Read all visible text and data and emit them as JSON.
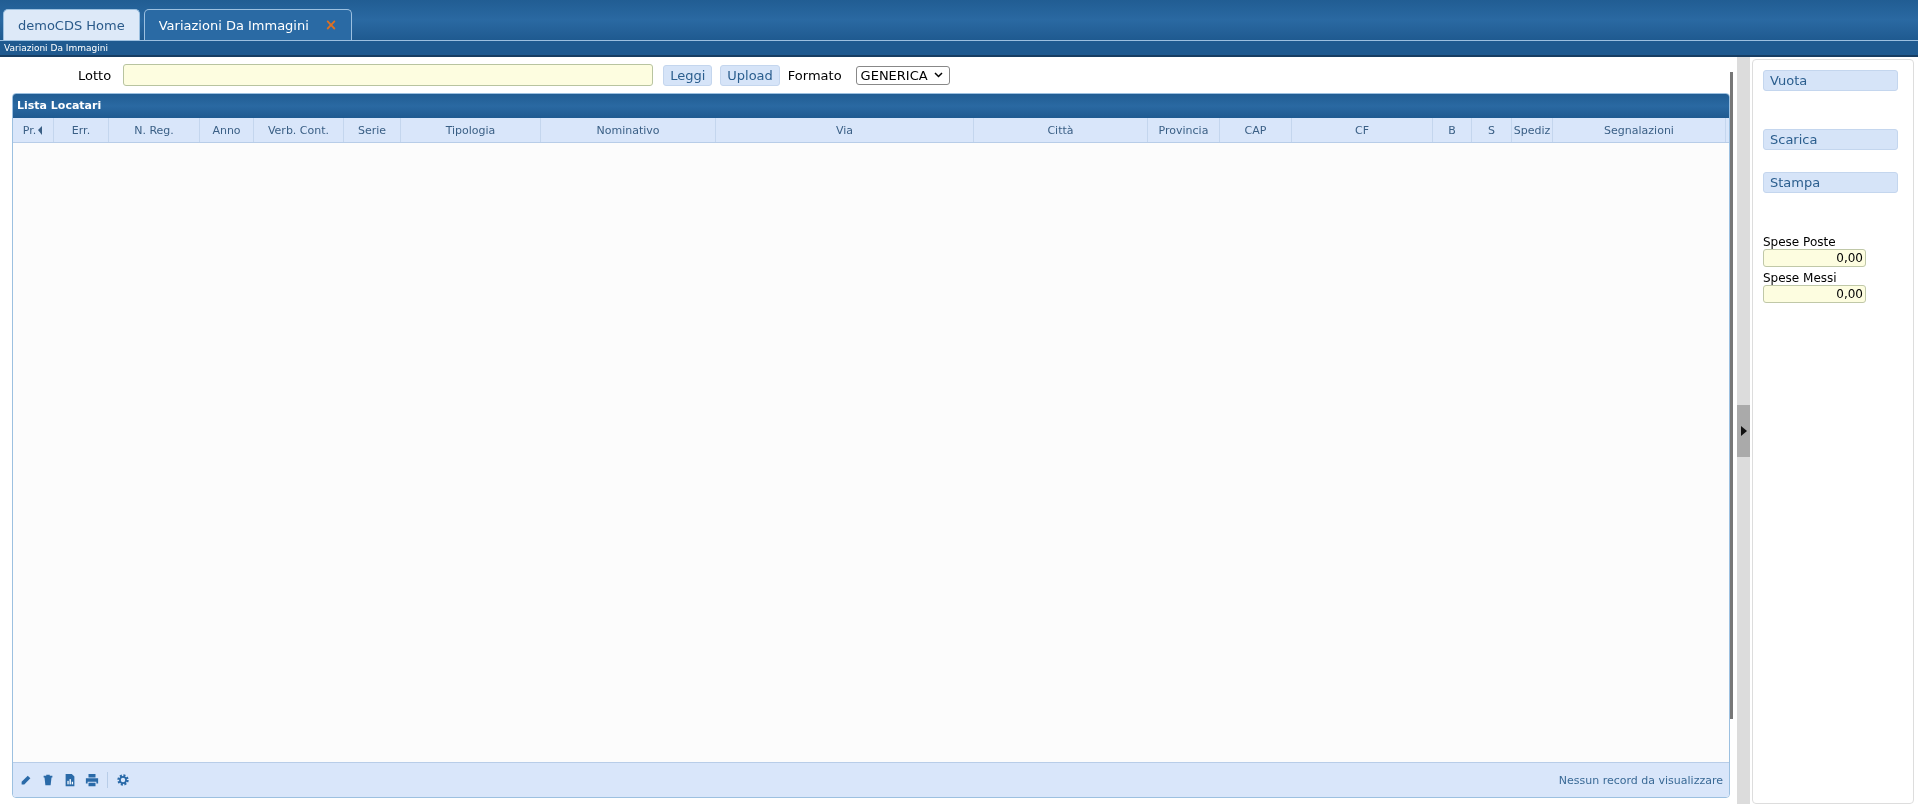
{
  "tabs": [
    {
      "label": "demoCDS Home",
      "selected": false
    },
    {
      "label": "Variazioni Da Immagini",
      "selected": true,
      "close": "×"
    }
  ],
  "breadcrumb": "Variazioni Da Immagini",
  "form": {
    "lotto_label": "Lotto",
    "read_button": "Leggi",
    "upload_button": "Upload",
    "format_label": "Formato",
    "format_value": "GENERICA"
  },
  "table": {
    "title": "Lista Locatari",
    "columns": [
      {
        "label": "Pr.",
        "sorted": true
      },
      {
        "label": "Err.",
        "sorted": false
      },
      {
        "label": "N. Reg.",
        "sorted": false
      },
      {
        "label": "Anno",
        "sorted": false
      },
      {
        "label": "Verb. Cont.",
        "sorted": false
      },
      {
        "label": "Serie",
        "sorted": false
      },
      {
        "label": "Tipologia",
        "sorted": false
      },
      {
        "label": "Nominativo",
        "sorted": false
      },
      {
        "label": "Via",
        "sorted": false
      },
      {
        "label": "Città",
        "sorted": false
      },
      {
        "label": "Provincia",
        "sorted": false
      },
      {
        "label": "CAP",
        "sorted": false
      },
      {
        "label": "CF",
        "sorted": false
      },
      {
        "label": "B",
        "sorted": false
      },
      {
        "label": "S",
        "sorted": false
      },
      {
        "label": "Spediz",
        "sorted": false
      },
      {
        "label": "Segnalazioni",
        "sorted": false
      }
    ],
    "toolbar": [
      {
        "kind": "edit"
      },
      {
        "kind": "delete"
      },
      {
        "kind": "report"
      },
      {
        "kind": "print"
      },
      {
        "kind": "settings"
      }
    ],
    "empty_message": "Nessun record da visualizzare"
  },
  "side": {
    "buttons": [
      {
        "label": "Vuota"
      },
      {
        "label": "Scarica"
      },
      {
        "label": "Stampa"
      }
    ],
    "fields": [
      {
        "label": "Spese Poste",
        "value": "0,00"
      },
      {
        "label": "Spese Messi",
        "value": "0,00"
      }
    ]
  }
}
